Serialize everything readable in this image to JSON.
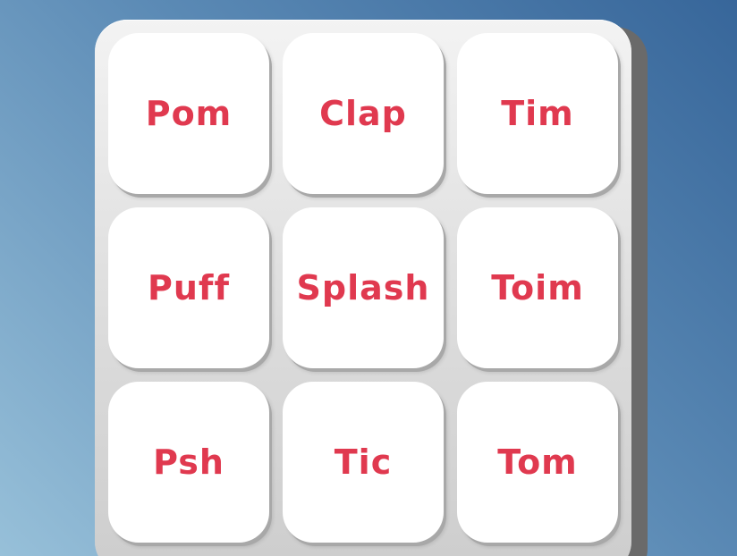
{
  "drum_pad": {
    "pads": [
      {
        "label": "Pom"
      },
      {
        "label": "Clap"
      },
      {
        "label": "Tim"
      },
      {
        "label": "Puff"
      },
      {
        "label": "Splash"
      },
      {
        "label": "Toim"
      },
      {
        "label": "Psh"
      },
      {
        "label": "Tic"
      },
      {
        "label": "Tom"
      }
    ]
  },
  "colors": {
    "label": "#e0394f",
    "pad": "#ffffff",
    "frame": "#dcdcdc",
    "background_top_right": "#37669a",
    "background_bottom_left": "#97c0d9"
  }
}
